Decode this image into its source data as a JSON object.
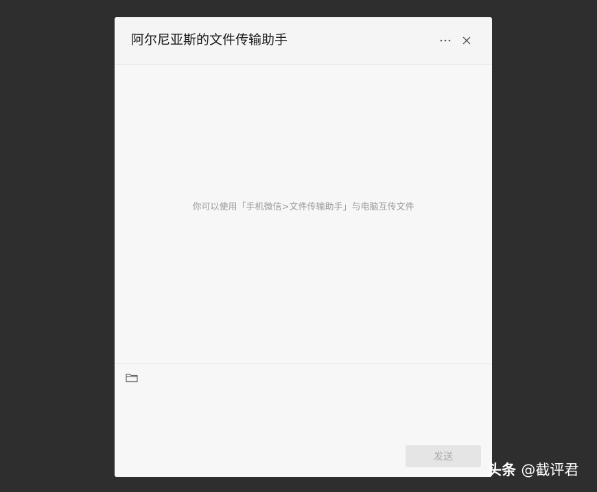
{
  "window": {
    "title": "阿尔尼亚斯的文件传输助手"
  },
  "icons": {
    "more": "more-horizontal-icon",
    "close": "close-icon",
    "folder": "folder-icon"
  },
  "messages": {
    "hint": "你可以使用「手机微信>文件传输助手」与电脑互传文件"
  },
  "composer": {
    "send_label": "发送",
    "input_value": ""
  },
  "watermark": {
    "brand": "头条",
    "handle": "@截评君"
  },
  "colors": {
    "backdrop": "#2e2e2e",
    "window_bg": "#f5f5f5",
    "hint_text": "#9a9a9a",
    "send_disabled_bg": "#e5e5e5",
    "send_disabled_text": "#a8a8a8"
  }
}
